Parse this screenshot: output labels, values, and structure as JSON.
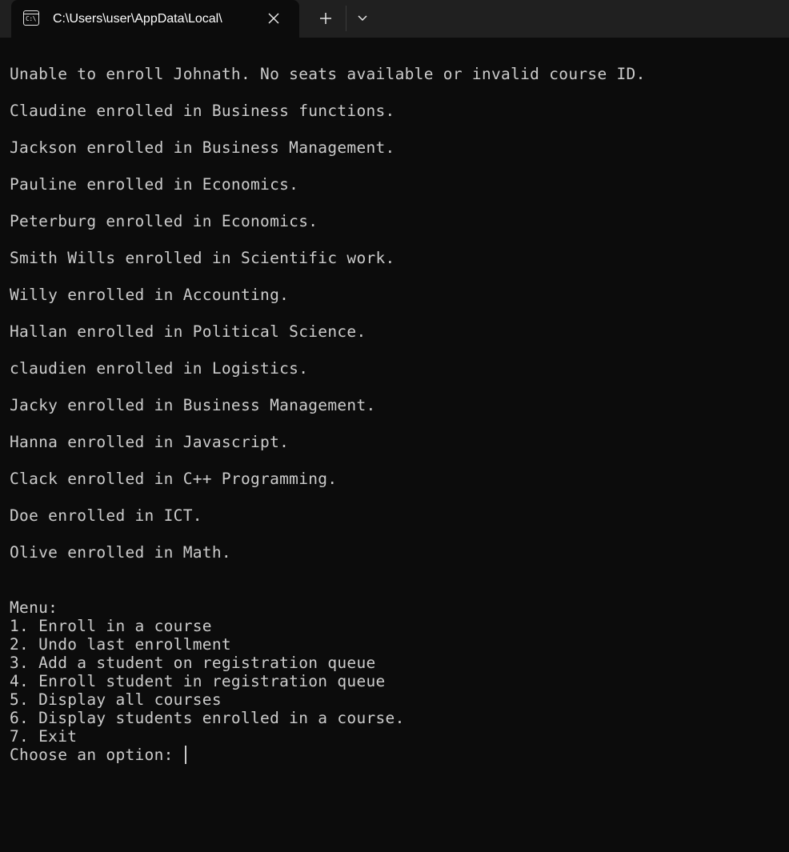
{
  "tab": {
    "icon": "terminal-icon",
    "icon_text": "C:\\",
    "title": "C:\\Users\\user\\AppData\\Local\\"
  },
  "terminal": {
    "output_lines": [
      "Unable to enroll Johnath. No seats available or invalid course ID.",
      "",
      "Claudine enrolled in Business functions.",
      "",
      "Jackson enrolled in Business Management.",
      "",
      "Pauline enrolled in Economics.",
      "",
      "Peterburg enrolled in Economics.",
      "",
      "Smith Wills enrolled in Scientific work.",
      "",
      "Willy enrolled in Accounting.",
      "",
      "Hallan enrolled in Political Science.",
      "",
      "claudien enrolled in Logistics.",
      "",
      "Jacky enrolled in Business Management.",
      "",
      "Hanna enrolled in Javascript.",
      "",
      "Clack enrolled in C++ Programming.",
      "",
      "Doe enrolled in ICT.",
      "",
      "Olive enrolled in Math.",
      "",
      "",
      "Menu:",
      "1. Enroll in a course",
      "2. Undo last enrollment",
      "3. Add a student on registration queue",
      "4. Enroll student in registration queue",
      "5. Display all courses",
      "6. Display students enrolled in a course.",
      "7. Exit"
    ],
    "prompt": "Choose an option: "
  }
}
